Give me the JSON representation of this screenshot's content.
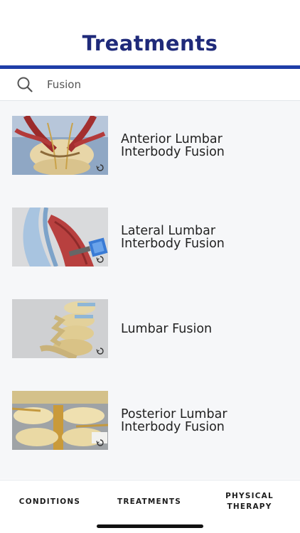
{
  "header": {
    "title": "Treatments"
  },
  "search": {
    "value": "Fusion"
  },
  "treatments": [
    {
      "line1": "Anterior Lumbar",
      "line2": "Interbody Fusion"
    },
    {
      "line1": "Lateral Lumbar",
      "line2": "Interbody Fusion"
    },
    {
      "line1": "Lumbar Fusion",
      "line2": ""
    },
    {
      "line1": "Posterior Lumbar",
      "line2": "Interbody Fusion"
    }
  ],
  "tabs": {
    "conditions": "CONDITIONS",
    "treatments": "TREATMENTS",
    "physical_line1": "PHYSICAL",
    "physical_line2": "THERAPY"
  },
  "icons": {
    "search": "search-icon",
    "replay": "replay-icon"
  },
  "colors": {
    "title": "#1f2a7a",
    "accent_rule": "#1f3ea8",
    "list_background": "#f6f7f9"
  }
}
